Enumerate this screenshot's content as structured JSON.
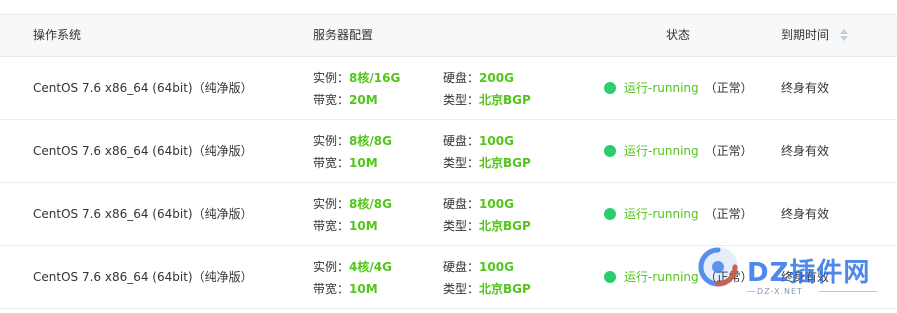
{
  "header": {
    "os": "操作系统",
    "config": "服务器配置",
    "status": "状态",
    "expire": "到期时间"
  },
  "rows": [
    {
      "os": "CentOS 7.6 x86_64 (64bit)（纯净版）",
      "cpu_label": "实例：",
      "cpu_value": "8核/16G",
      "disk_label": "硬盘：",
      "disk_value": "200G",
      "bandwidth_label": "带宽：",
      "bandwidth_value": "20M",
      "type_label": "类型：",
      "type_value": "北京BGP",
      "status": "运行-running",
      "status_note": "（正常）",
      "expire": "终身有效"
    },
    {
      "os": "CentOS 7.6 x86_64 (64bit)（纯净版）",
      "cpu_label": "实例：",
      "cpu_value": "8核/8G",
      "disk_label": "硬盘：",
      "disk_value": "100G",
      "bandwidth_label": "带宽：",
      "bandwidth_value": "10M",
      "type_label": "类型：",
      "type_value": "北京BGP",
      "status": "运行-running",
      "status_note": "（正常）",
      "expire": "终身有效"
    },
    {
      "os": "CentOS 7.6 x86_64 (64bit)（纯净版）",
      "cpu_label": "实例：",
      "cpu_value": "8核/8G",
      "disk_label": "硬盘：",
      "disk_value": "100G",
      "bandwidth_label": "带宽：",
      "bandwidth_value": "10M",
      "type_label": "类型：",
      "type_value": "北京BGP",
      "status": "运行-running",
      "status_note": "（正常）",
      "expire": "终身有效"
    },
    {
      "os": "CentOS 7.6 x86_64 (64bit)（纯净版）",
      "cpu_label": "实例：",
      "cpu_value": "4核/4G",
      "disk_label": "硬盘：",
      "disk_value": "100G",
      "bandwidth_label": "带宽：",
      "bandwidth_value": "10M",
      "type_label": "类型：",
      "type_value": "北京BGP",
      "status": "运行-running",
      "status_note": "（正常）",
      "expire": "终身有效"
    }
  ],
  "watermark": {
    "text": "DZ插件网",
    "sub": "DZ-X.NET"
  },
  "icons": {
    "sort": "sort-icon",
    "status_dot": "status-dot-icon",
    "watermark_logo": "dz-logo-icon"
  },
  "colors": {
    "accent_green": "#52c41a",
    "status_dot": "#2ecc71",
    "header_bg": "#f7f8fa",
    "watermark_blue": "#286ee6"
  }
}
